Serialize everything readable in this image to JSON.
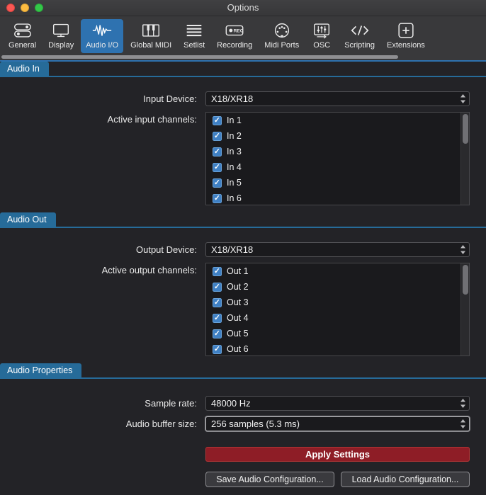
{
  "window": {
    "title": "Options"
  },
  "toolbar": {
    "items": [
      {
        "label": "General",
        "icon": "toggles-icon",
        "selected": false
      },
      {
        "label": "Display",
        "icon": "display-icon",
        "selected": false
      },
      {
        "label": "Audio I/O",
        "icon": "waveform-icon",
        "selected": true
      },
      {
        "label": "Global MIDI",
        "icon": "piano-icon",
        "selected": false
      },
      {
        "label": "Setlist",
        "icon": "setlist-icon",
        "selected": false
      },
      {
        "label": "Recording",
        "icon": "record-icon",
        "selected": false
      },
      {
        "label": "Midi Ports",
        "icon": "midi-din-icon",
        "selected": false
      },
      {
        "label": "OSC",
        "icon": "osc-icon",
        "selected": false
      },
      {
        "label": "Scripting",
        "icon": "code-icon",
        "selected": false
      },
      {
        "label": "Extensions",
        "icon": "extensions-icon",
        "selected": false
      }
    ]
  },
  "audio_in": {
    "section_title": "Audio In",
    "device_label": "Input Device:",
    "device_value": "X18/XR18",
    "channels_label": "Active input channels:",
    "channels": [
      {
        "label": "In 1",
        "checked": true
      },
      {
        "label": "In 2",
        "checked": true
      },
      {
        "label": "In 3",
        "checked": true
      },
      {
        "label": "In 4",
        "checked": true
      },
      {
        "label": "In 5",
        "checked": true
      },
      {
        "label": "In 6",
        "checked": true
      }
    ]
  },
  "audio_out": {
    "section_title": "Audio Out",
    "device_label": "Output Device:",
    "device_value": "X18/XR18",
    "channels_label": "Active output channels:",
    "channels": [
      {
        "label": "Out 1",
        "checked": true
      },
      {
        "label": "Out 2",
        "checked": true
      },
      {
        "label": "Out 3",
        "checked": true
      },
      {
        "label": "Out 4",
        "checked": true
      },
      {
        "label": "Out 5",
        "checked": true
      },
      {
        "label": "Out 6",
        "checked": true
      }
    ]
  },
  "audio_properties": {
    "section_title": "Audio Properties",
    "sample_rate_label": "Sample rate:",
    "sample_rate_value": "48000 Hz",
    "buffer_label": "Audio buffer size:",
    "buffer_value": "256 samples (5.3 ms)",
    "apply_button": "Apply Settings",
    "save_button": "Save Audio Configuration...",
    "load_button": "Load Audio Configuration..."
  },
  "colors": {
    "toolbar_selected_blue": "#2e72b0",
    "section_tab_blue": "#266b99",
    "apply_red": "#8e1d26",
    "checkbox_blue": "#3f80c4",
    "content_bg": "#232327",
    "chrome_bg": "#39393b"
  }
}
